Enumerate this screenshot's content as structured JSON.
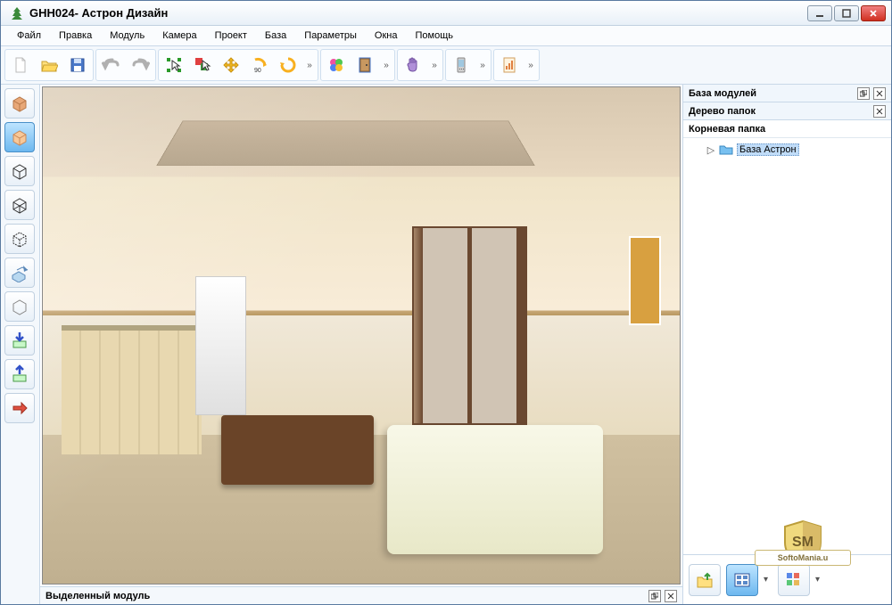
{
  "window": {
    "title": "GHH024- Астрон Дизайн"
  },
  "menu": {
    "items": [
      "Файл",
      "Правка",
      "Модуль",
      "Камера",
      "Проект",
      "База",
      "Параметры",
      "Окна",
      "Помощь"
    ]
  },
  "toolbar": {
    "groups": [
      {
        "buttons": [
          "new-file",
          "open-folder",
          "save"
        ],
        "expand": false
      },
      {
        "buttons": [
          "undo",
          "redo"
        ],
        "expand": false
      },
      {
        "buttons": [
          "select-bounds",
          "select-add",
          "move-xy",
          "rotate-90",
          "rotate-free"
        ],
        "expand": true
      },
      {
        "buttons": [
          "materials",
          "door"
        ],
        "expand": true
      },
      {
        "buttons": [
          "pan-hand"
        ],
        "expand": true
      },
      {
        "buttons": [
          "phone"
        ],
        "expand": true
      },
      {
        "buttons": [
          "report"
        ],
        "expand": true
      }
    ]
  },
  "left_tools": [
    {
      "name": "box-solid",
      "active": false
    },
    {
      "name": "box-shaded",
      "active": true
    },
    {
      "name": "box-wire1",
      "active": false
    },
    {
      "name": "box-wire2",
      "active": false
    },
    {
      "name": "box-wire3",
      "active": false
    },
    {
      "name": "extrude",
      "active": false
    },
    {
      "name": "box-empty",
      "active": false
    },
    {
      "name": "import-down",
      "active": false
    },
    {
      "name": "export-up",
      "active": false
    },
    {
      "name": "forward-arrow",
      "active": false
    }
  ],
  "right_panel": {
    "title": "База модулей",
    "tree_title": "Дерево папок",
    "root_label": "Корневая папка",
    "child_label": "База Астрон"
  },
  "bottom_panel": {
    "title": "Выделенный модуль"
  },
  "watermark": {
    "text": "SoftoMania.u"
  }
}
